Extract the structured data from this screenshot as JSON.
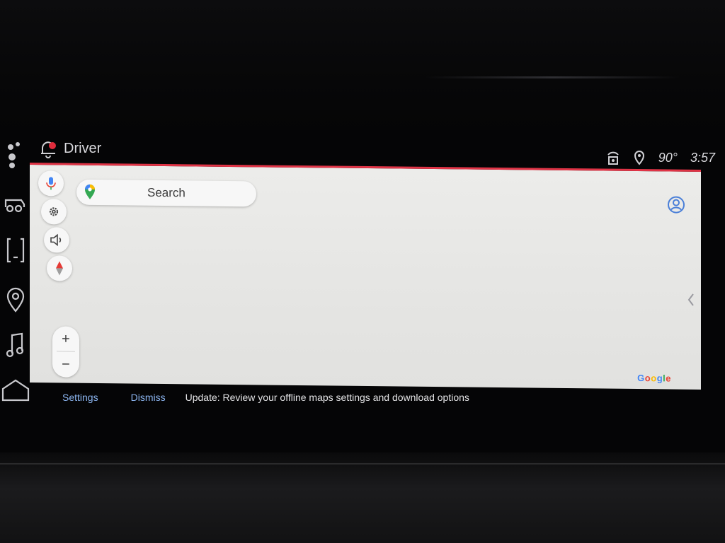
{
  "status_bar": {
    "profile_name": "Driver",
    "temperature": "90°",
    "time": "3:57",
    "icons": [
      "connectivity-icon",
      "location-icon"
    ]
  },
  "rail": {
    "items": [
      "assistant-icon",
      "vehicle-icon",
      "phone-icon",
      "navigation-icon",
      "music-icon",
      "home-icon"
    ]
  },
  "map": {
    "search_placeholder": "Search",
    "attribution": "Google",
    "controls": [
      "mic-icon",
      "settings-icon",
      "sound-icon",
      "compass-icon"
    ],
    "zoom": {
      "in_label": "+",
      "out_label": "−"
    },
    "accent_color": "#e03446"
  },
  "notification": {
    "settings_label": "Settings",
    "dismiss_label": "Dismiss",
    "message": "Update: Review your offline maps settings and download options"
  }
}
